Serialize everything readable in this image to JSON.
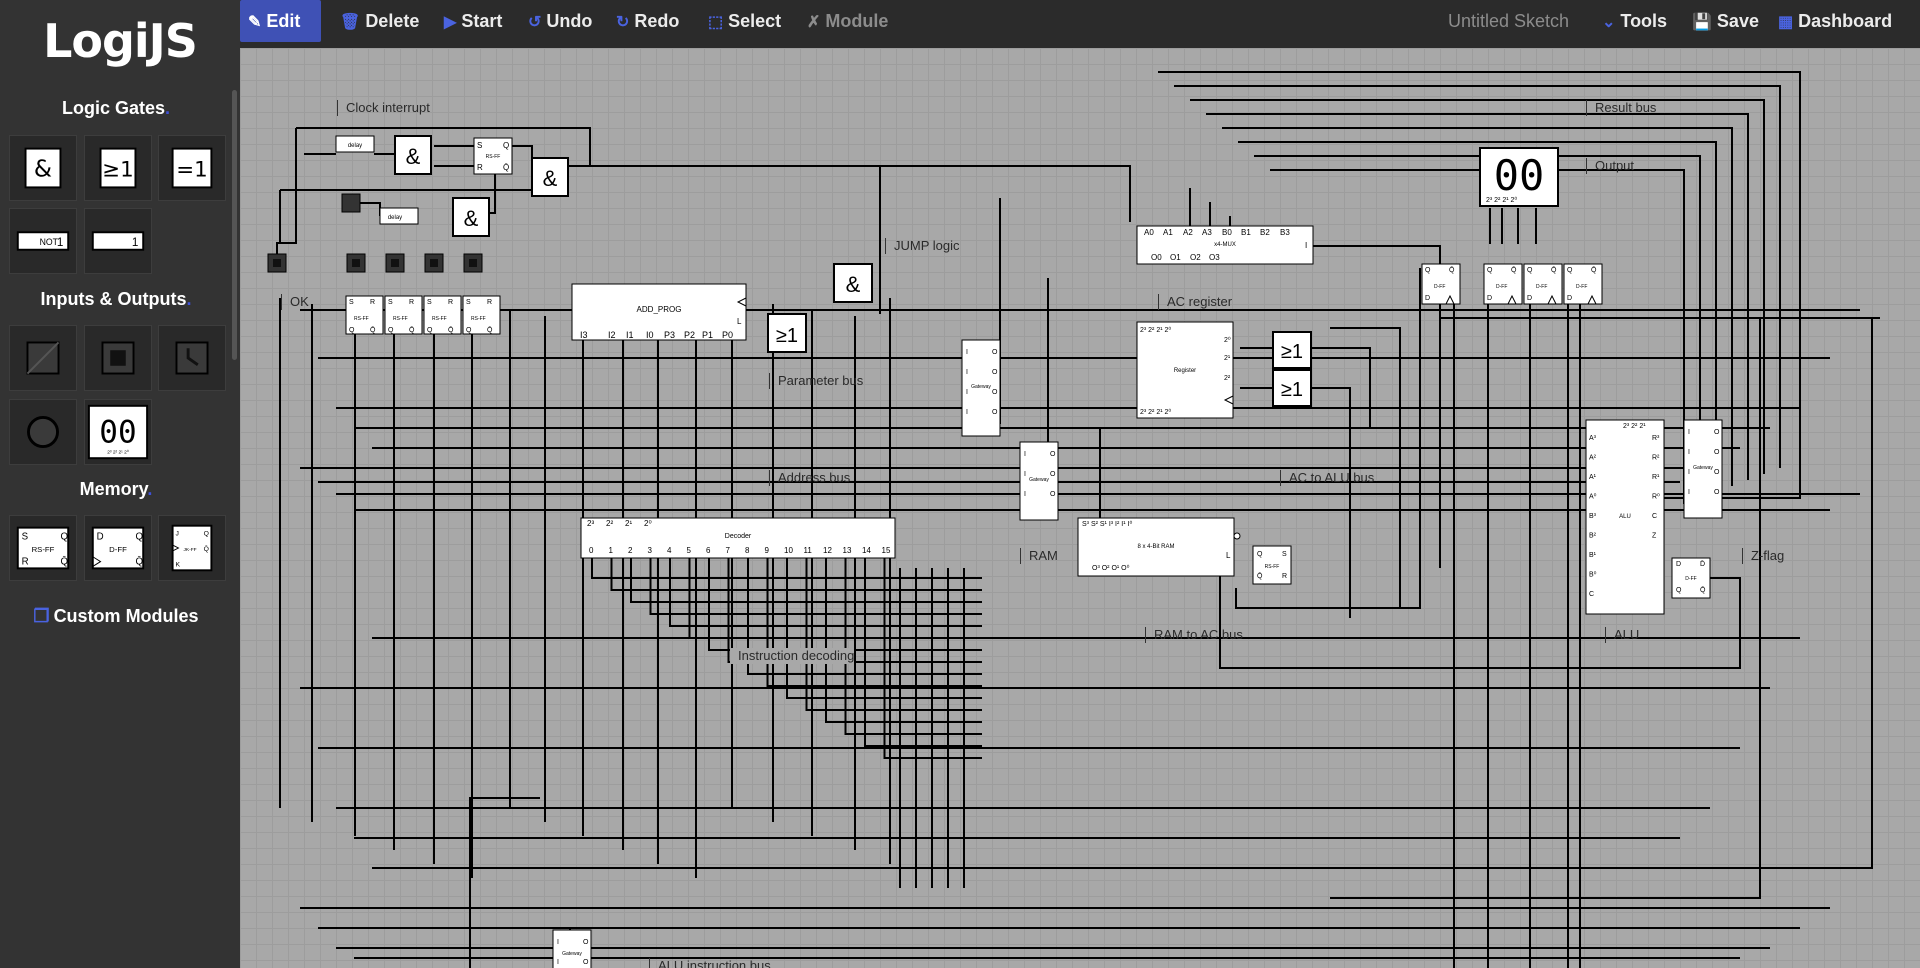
{
  "app": {
    "title": "LogiJS"
  },
  "sidebar": {
    "sections": [
      {
        "title": "Logic Gates",
        "items": [
          "&",
          "≥1",
          "=1",
          "NOT",
          "1"
        ]
      },
      {
        "title": "Inputs & Outputs",
        "items": [
          "input",
          "button",
          "clock",
          "lamp",
          "00"
        ]
      },
      {
        "title": "Memory",
        "items": [
          "RS-FF",
          "D-FF",
          "JK-FF"
        ]
      }
    ],
    "custom_modules": "Custom Modules"
  },
  "toolbar": {
    "edit": "Edit",
    "delete": "Delete",
    "start": "Start",
    "undo": "Undo",
    "redo": "Redo",
    "select": "Select",
    "module": "Module",
    "sketch_name": "Untitled Sketch",
    "tools": "Tools",
    "save": "Save",
    "dashboard": "Dashboard"
  },
  "icons": {
    "edit": "pencil-icon",
    "delete": "trash-icon",
    "start": "play-icon",
    "undo": "undo-icon",
    "redo": "redo-icon",
    "select": "select-icon",
    "module": "wrench-icon",
    "tools": "chevron-down-icon",
    "save": "floppy-icon",
    "dashboard": "grid-icon",
    "custom_modules": "copy-icon"
  },
  "canvas": {
    "labels": {
      "clock_interrupt": "Clock interrupt",
      "ok": "OK",
      "jump_logic": "JUMP logic",
      "parameter_bus": "Parameter bus",
      "address_bus": "Address bus",
      "ac_register": "AC register",
      "ac_to_alu_bus": "AC to ALU bus",
      "ram": "RAM",
      "ram_to_ac_bus": "RAM to AC bus",
      "instruction_decoding": "Instruction decoding",
      "result_bus": "Result bus",
      "output": "Output",
      "z_flag": "Z-flag",
      "alu": "ALU",
      "alu_instruction_bus": "ALU instruction bus"
    },
    "components": {
      "delay": "delay",
      "and": "&",
      "or": "≥1",
      "rs_ff": "RS-FF",
      "d_ff": "D-FF",
      "add_prog": "ADD_PROG",
      "decoder": "Decoder",
      "mux": "x4-MUX",
      "register": "Register",
      "ram": "8 x 4-Bit RAM",
      "gateway": "Gateway",
      "alu": "ALU",
      "display": "00"
    }
  },
  "colors": {
    "accent": "#3f51b5",
    "sidebar": "#333333",
    "canvas": "#a8a8a8"
  }
}
